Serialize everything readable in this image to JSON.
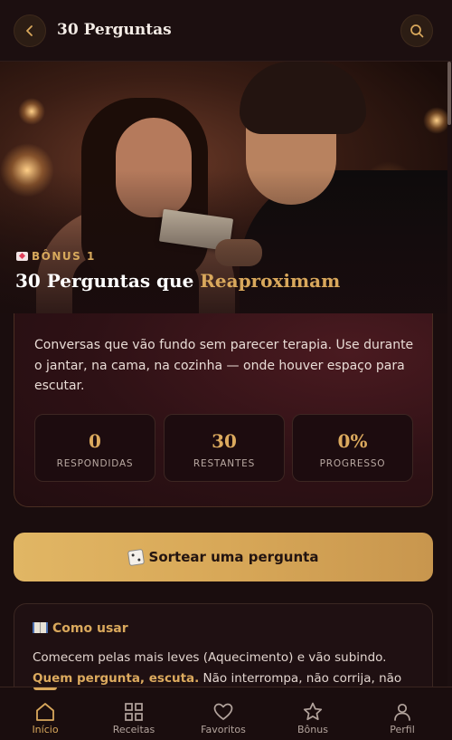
{
  "header": {
    "title": "30 Perguntas",
    "back_icon": "chevron-left-icon",
    "search_icon": "search-icon"
  },
  "hero": {
    "tag": "BÔNUS 1",
    "title_main": "30 Perguntas que ",
    "title_accent": "Reaproximam"
  },
  "intro": {
    "text": "Conversas que vão fundo sem parecer terapia. Use durante o jantar, na cama, na cozinha — onde houver espaço para escutar."
  },
  "stats": [
    {
      "value": "0",
      "label": "RESPONDIDAS"
    },
    {
      "value": "30",
      "label": "RESTANTES"
    },
    {
      "value": "0%",
      "label": "PROGRESSO"
    }
  ],
  "cta": {
    "label": "Sortear uma pergunta",
    "icon": "dice-icon"
  },
  "howto": {
    "title": "Como usar",
    "text_1": "Comecem pelas mais leves (Aquecimento) e vão subindo. ",
    "text_highlight": "Quem pergunta, escuta.",
    "text_2": " Não interrompa, não corrija, não defenda. Só"
  },
  "nav": [
    {
      "label": "Início",
      "icon": "home-icon",
      "active": true
    },
    {
      "label": "Receitas",
      "icon": "grid-icon",
      "active": false
    },
    {
      "label": "Favoritos",
      "icon": "heart-icon",
      "active": false
    },
    {
      "label": "Bônus",
      "icon": "star-icon",
      "active": false
    },
    {
      "label": "Perfil",
      "icon": "user-icon",
      "active": false
    }
  ],
  "colors": {
    "accent": "#d9a85c",
    "background": "#1a0d0e",
    "cta_gradient_start": "#e1b664"
  }
}
